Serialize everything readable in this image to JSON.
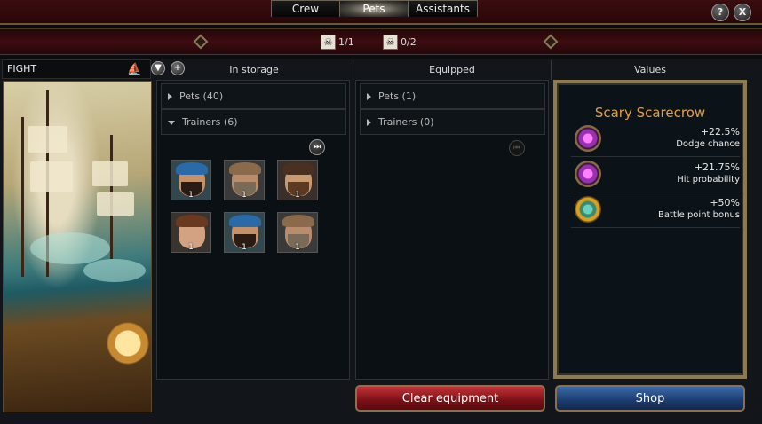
{
  "tabs": [
    {
      "label": "Crew",
      "active": false
    },
    {
      "label": "Pets",
      "active": true
    },
    {
      "label": "Assistants",
      "active": false
    }
  ],
  "top_buttons": {
    "help": "?",
    "close": "X"
  },
  "counters": {
    "first": "1/1",
    "second": "0/2"
  },
  "fight_header": {
    "label": "FIGHT",
    "filter_symbol": "▼",
    "add_symbol": "+"
  },
  "columns": {
    "storage": "In storage",
    "equipped": "Equipped",
    "values": "Values"
  },
  "storage": {
    "categories": [
      {
        "label": "Pets (40)",
        "expanded": false
      },
      {
        "label": "Trainers (6)",
        "expanded": true
      }
    ],
    "trainers": [
      {
        "qty": "1",
        "portrait": "blue-bandana-trainer"
      },
      {
        "qty": "1",
        "portrait": "old-bearded-trainer"
      },
      {
        "qty": "1",
        "portrait": "bearded-trainer"
      },
      {
        "qty": "1",
        "portrait": "female-trainer"
      },
      {
        "qty": "1",
        "portrait": "blue-bandana-trainer"
      },
      {
        "qty": "1",
        "portrait": "old-bearded-trainer"
      }
    ]
  },
  "equipped": {
    "categories": [
      {
        "label": "Pets (1)",
        "expanded": false
      },
      {
        "label": "Trainers (0)",
        "expanded": false
      }
    ]
  },
  "values_panel": {
    "title": "Scary Scarecrow",
    "rows": [
      {
        "amount": "+22.5%",
        "label": "Dodge chance",
        "icon": "purple-gem-icon"
      },
      {
        "amount": "+21.75%",
        "label": "Hit probability",
        "icon": "purple-gem-icon"
      },
      {
        "amount": "+50%",
        "label": "Battle point bonus",
        "icon": "gold-gem-icon"
      }
    ]
  },
  "buttons": {
    "clear": "Clear equipment",
    "shop": "Shop"
  },
  "colors": {
    "accent_orange": "#e2a040",
    "frame_gold": "#8c7a50",
    "clear_red": "#a01c22",
    "shop_blue": "#2a5090"
  }
}
